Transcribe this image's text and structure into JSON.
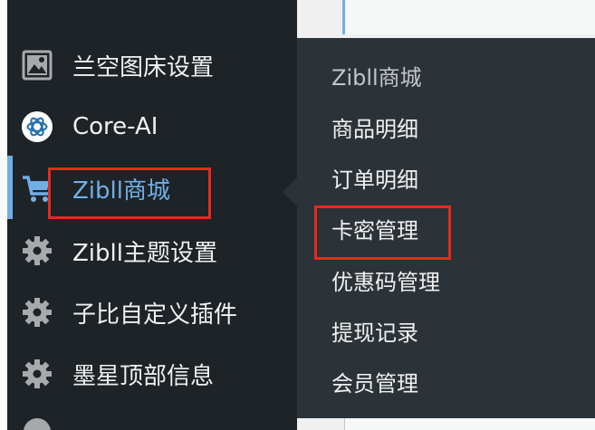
{
  "sidebar": {
    "items": [
      {
        "label": "兰空图床设置",
        "icon": "image-icon"
      },
      {
        "label": "Core-AI",
        "icon": "openai-icon"
      },
      {
        "label": "Zibll商城",
        "icon": "cart-icon",
        "active": true
      },
      {
        "label": "Zibll主题设置",
        "icon": "gear-icon"
      },
      {
        "label": "子比自定义插件",
        "icon": "gear-icon"
      },
      {
        "label": "墨星顶部信息",
        "icon": "gear-icon"
      }
    ]
  },
  "submenu": {
    "items": [
      {
        "label": "Zibll商城"
      },
      {
        "label": "商品明细"
      },
      {
        "label": "订单明细"
      },
      {
        "label": "卡密管理",
        "highlighted": true
      },
      {
        "label": "优惠码管理"
      },
      {
        "label": "提现记录"
      },
      {
        "label": "会员管理"
      }
    ]
  },
  "colors": {
    "sidebar_bg": "#1d2327",
    "submenu_bg": "#2c3338",
    "accent": "#72aee6",
    "highlight_border": "#e8291c"
  }
}
